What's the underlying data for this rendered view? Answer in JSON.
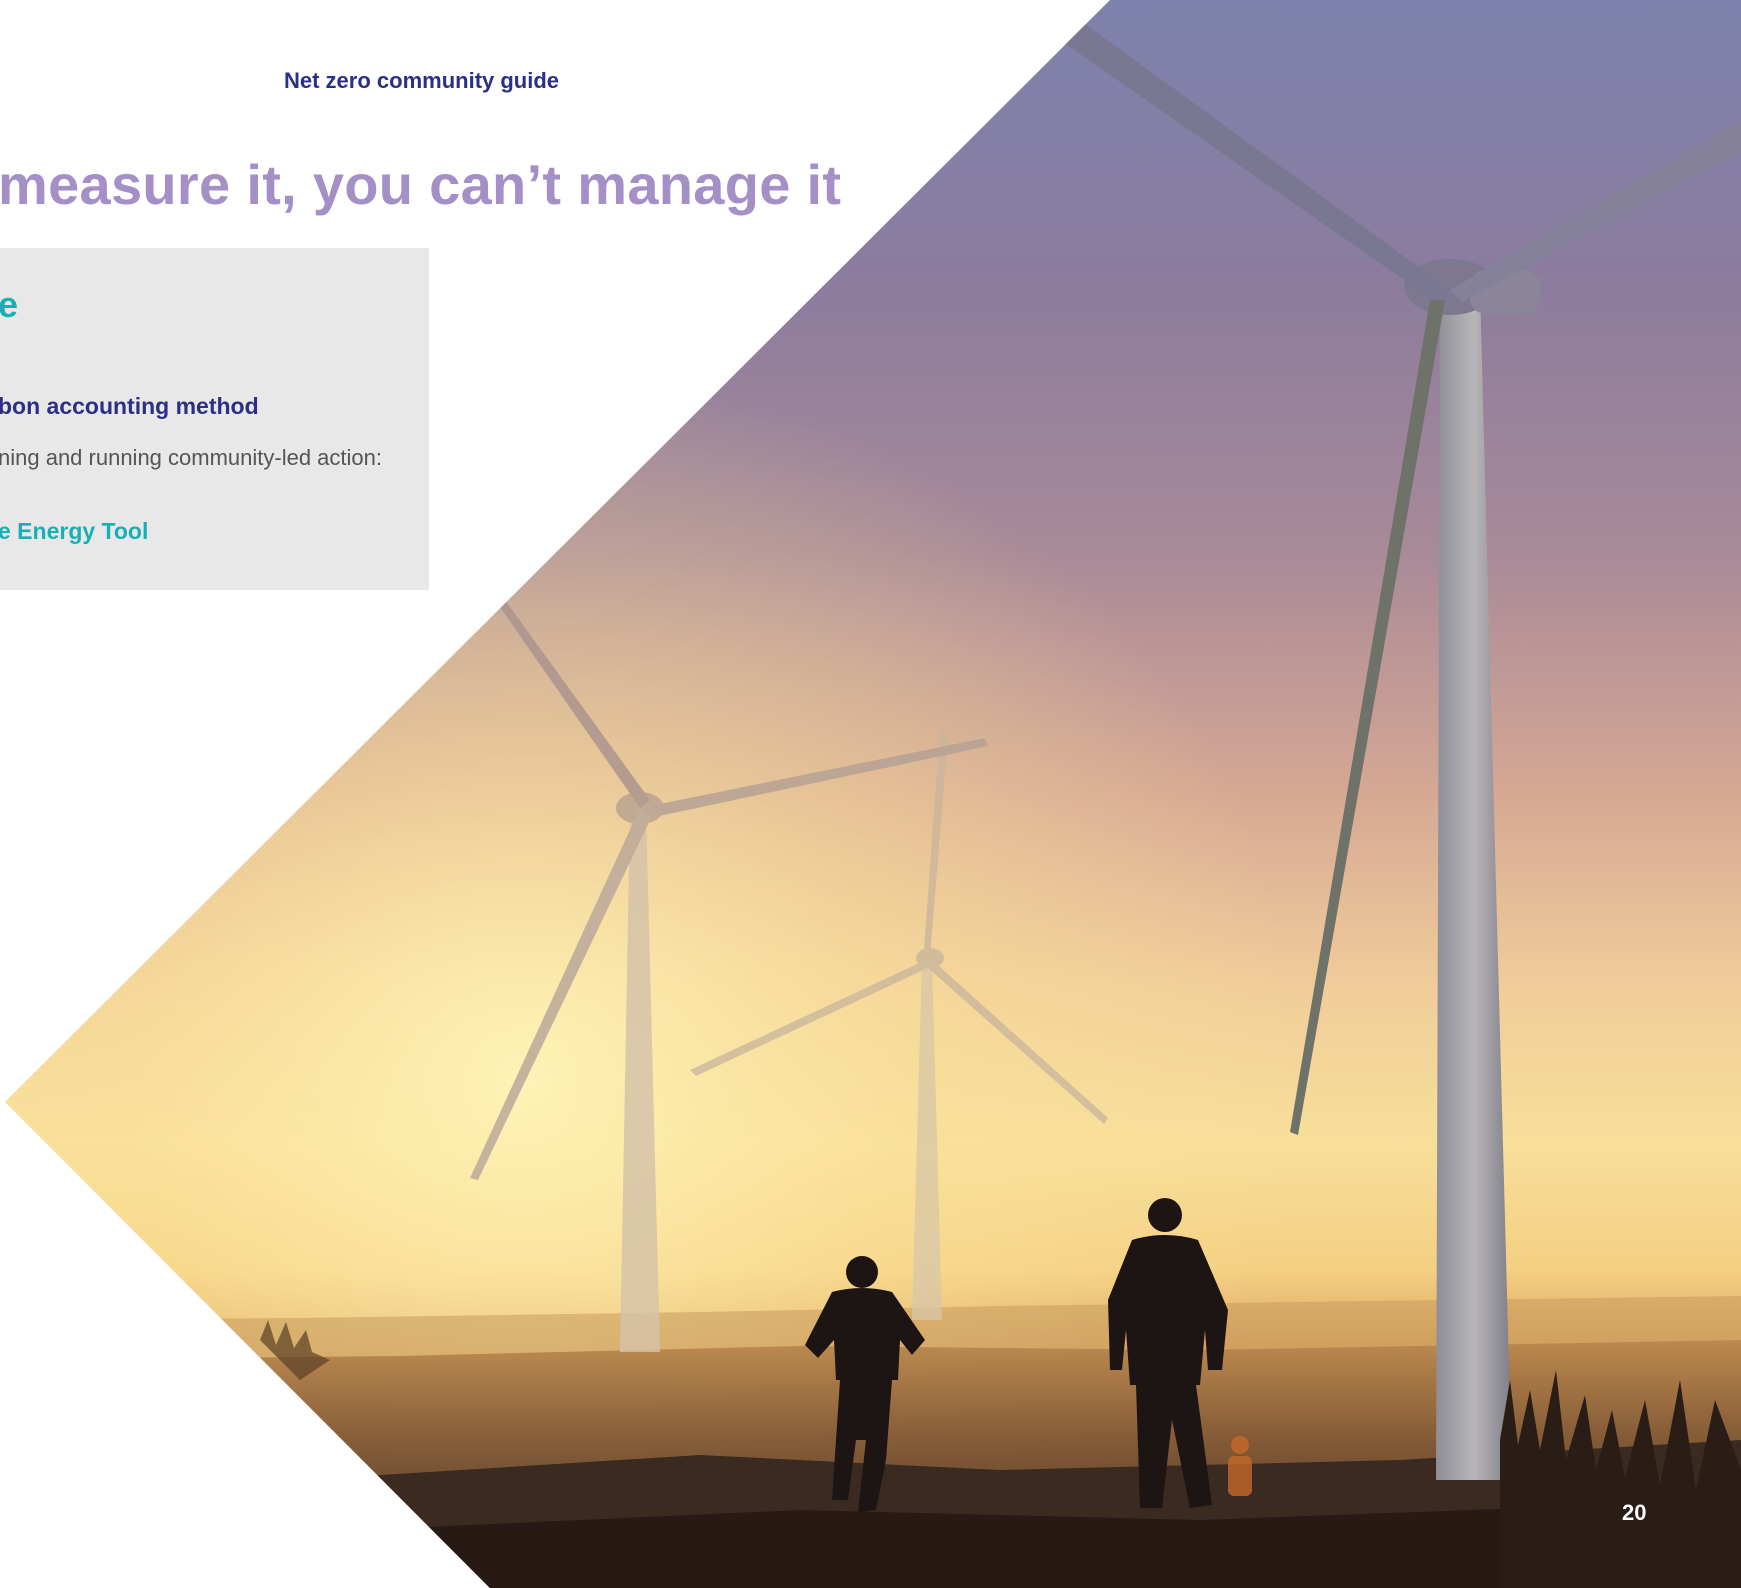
{
  "header": {
    "title": "Net zero community guide"
  },
  "main": {
    "heading": "measure it, you can’t manage it"
  },
  "info_box": {
    "heading": "e",
    "subheading": "bon accounting method",
    "body": "ning and running community-led action:",
    "link": "e Energy Tool"
  },
  "footer": {
    "page_number": "20"
  },
  "colors": {
    "navy": "#2b2f86",
    "lavender": "#a58fc7",
    "teal": "#17b0b5",
    "box_grey": "#e8e8e9"
  },
  "photo": {
    "subject": "wind-turbines-sunset-photo"
  }
}
